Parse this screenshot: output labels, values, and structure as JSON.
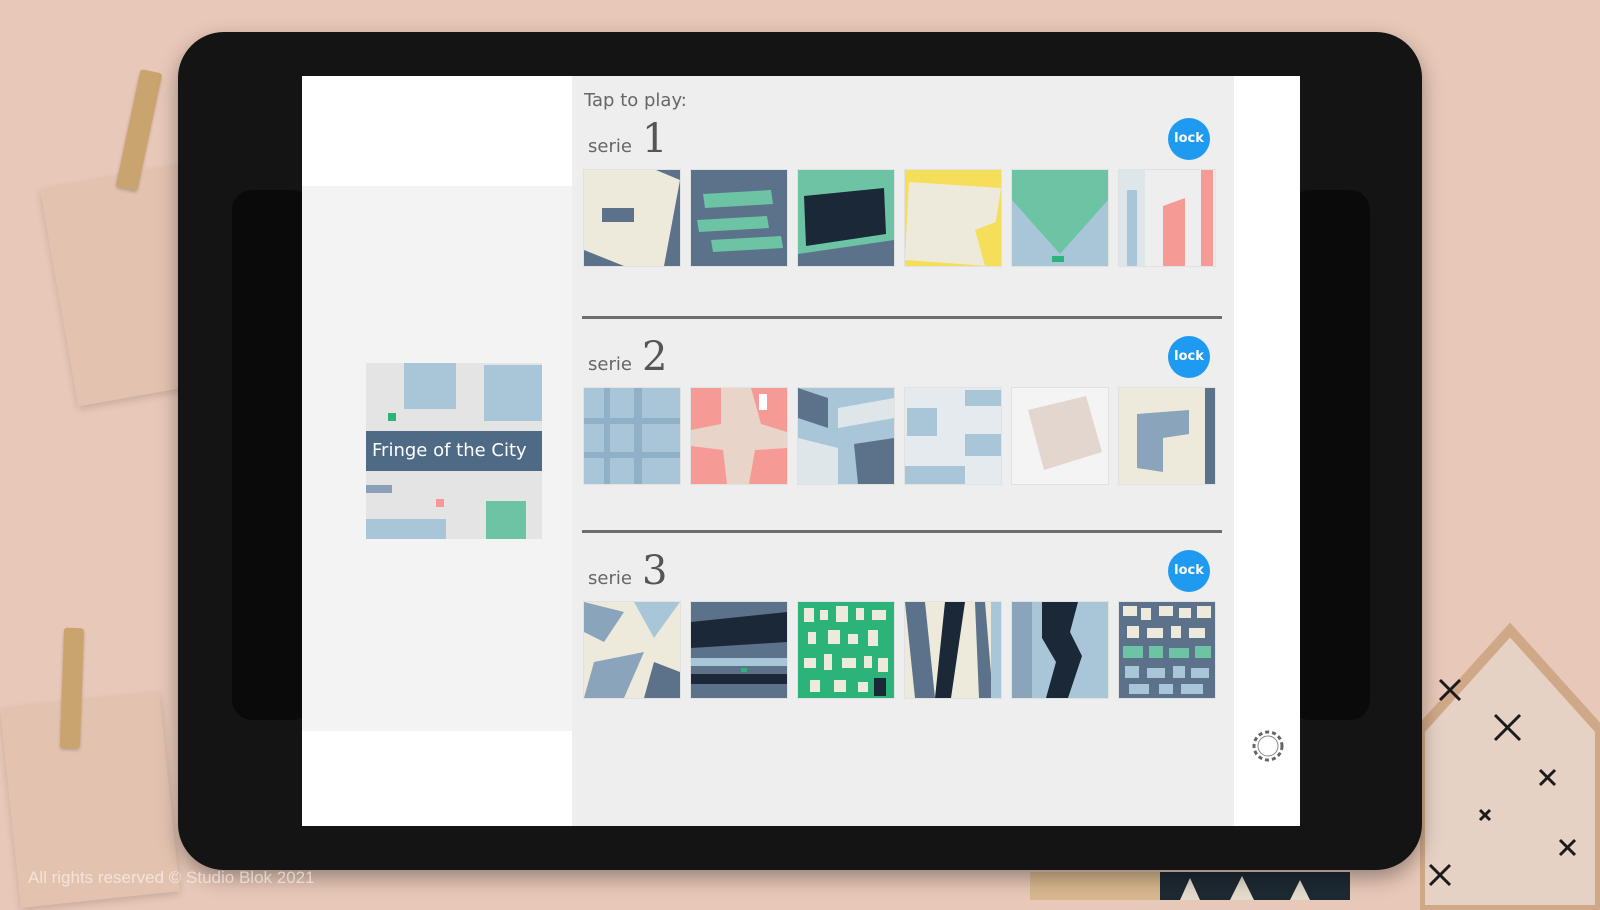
{
  "screen": {
    "tap_label": "Tap to play:"
  },
  "preview": {
    "title": "Fringe of the City"
  },
  "series": [
    {
      "word": "serie",
      "number": "1",
      "lock_label": "lock"
    },
    {
      "word": "serie",
      "number": "2",
      "lock_label": "lock"
    },
    {
      "word": "serie",
      "number": "3",
      "lock_label": "lock"
    }
  ],
  "settings": {
    "icon": "gear-icon"
  },
  "footer": {
    "copyright": "All rights reserved © Studio Blok 2021"
  },
  "colors": {
    "accent": "#1e9bf0",
    "slate": "#5c718a",
    "mint": "#6cc4a4",
    "cream": "#eeeadb",
    "sky": "#a9c6d8",
    "pink": "#f59a94",
    "yellow": "#f5df5a",
    "navy": "#1b2838"
  }
}
